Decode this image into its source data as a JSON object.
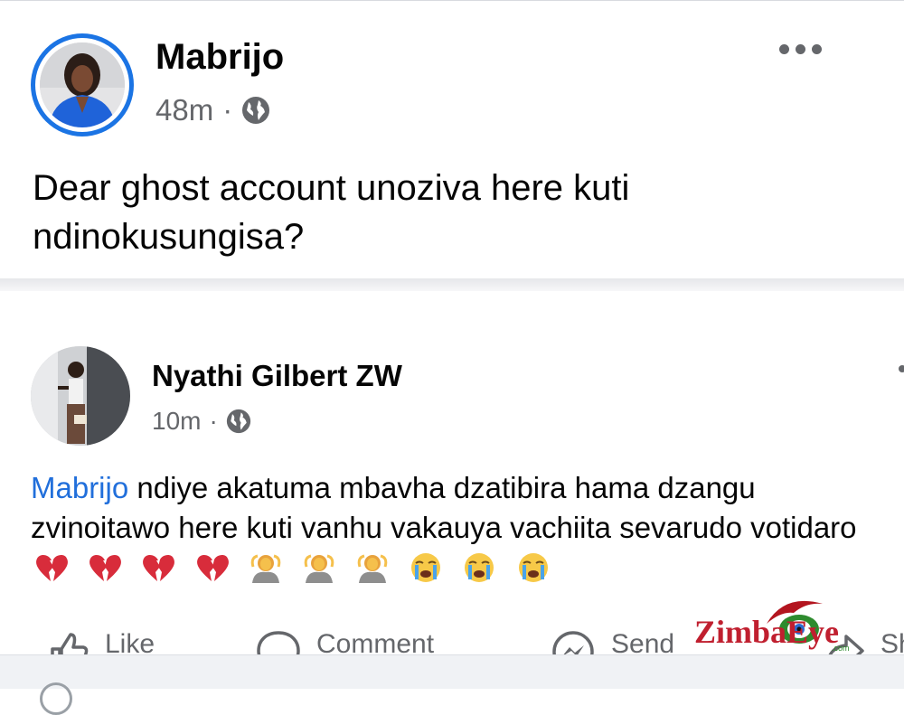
{
  "post": {
    "author": "Mabrijo",
    "time": "48m",
    "separator": "·",
    "privacy_icon": "globe-icon",
    "more_icon": "more-options-icon",
    "text": "Dear ghost account unoziva here kuti ndinokusungisa?"
  },
  "shared_post": {
    "author": "Nyathi Gilbert ZW",
    "time": "10m",
    "separator": "·",
    "privacy_icon": "globe-icon",
    "mention": "Mabrijo",
    "text": " ndiye akatuma mbavha dzatibira hama dzangu zvinoitawo here kuti vanhu vakauya vachiita sevarudo votidaro",
    "emojis": [
      "broken-heart",
      "broken-heart",
      "broken-heart",
      "broken-heart",
      "person-gesturing-ok",
      "person-gesturing-ok",
      "person-gesturing-ok",
      "loudly-crying-face",
      "loudly-crying-face",
      "loudly-crying-face"
    ]
  },
  "actions": {
    "like": "Like",
    "comment": "Comment",
    "send": "Send",
    "share": "Share"
  },
  "watermark": {
    "brand": "ZimbaEye",
    "domain": ".com"
  },
  "colors": {
    "accent": "#1b74e4",
    "mention": "#216fdb",
    "watermark_red": "#c01f2f"
  }
}
